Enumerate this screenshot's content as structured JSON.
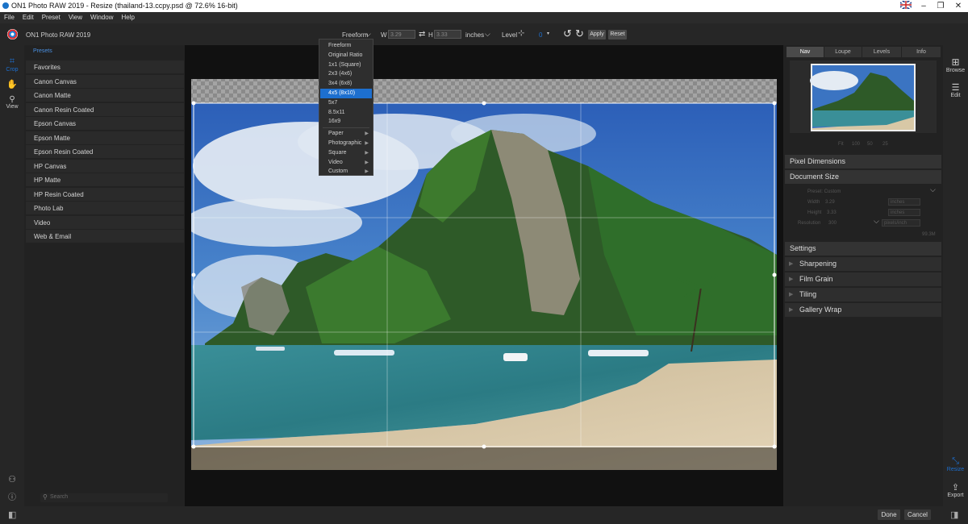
{
  "window": {
    "title": "ON1 Photo RAW 2019 - Resize (thailand-13.ccpy.psd @ 72.6% 16-bit)"
  },
  "menubar": [
    "File",
    "Edit",
    "Preset",
    "View",
    "Window",
    "Help"
  ],
  "toolbar": {
    "app_name": "ON1 Photo RAW 2019",
    "aspect": "Freeform",
    "w_label": "W",
    "w_value": "3.29",
    "h_label": "H",
    "h_value": "3.33",
    "units": "inches",
    "level_label": "Level",
    "level_value": "0",
    "apply": "Apply",
    "reset": "Reset"
  },
  "left_rail": {
    "crop": "Crop",
    "view": "View"
  },
  "presets": {
    "header": "Presets",
    "items": [
      "Favorites",
      "Canon Canvas",
      "Canon Matte",
      "Canon Resin Coated",
      "Epson Canvas",
      "Epson Matte",
      "Epson Resin Coated",
      "HP Canvas",
      "HP Matte",
      "HP Resin Coated",
      "Photo Lab",
      "Video",
      "Web & Email"
    ],
    "search_placeholder": "Search"
  },
  "dropdown": {
    "items": [
      "Freeform",
      "Original Ratio",
      "1x1 (Square)",
      "2x3 (4x6)",
      "3x4 (6x8)",
      "4x5 (8x10)",
      "5x7",
      "8.5x11",
      "16x9"
    ],
    "selected_index": 5,
    "submenus": [
      "Paper",
      "Photographic",
      "Square",
      "Video",
      "Custom"
    ]
  },
  "right_panel": {
    "tabs": [
      "Nav",
      "Loupe",
      "Levels",
      "Info"
    ],
    "active_tab": 0,
    "zoom_options": [
      "Fit",
      "100",
      "50",
      "25"
    ],
    "pixel_dimensions": "Pixel Dimensions",
    "document_size": "Document Size",
    "preset": "Preset: Custom",
    "width_row": {
      "label": "Width",
      "value": "3.29",
      "unit": "inches"
    },
    "height_row": {
      "label": "Height",
      "value": "3.33",
      "unit": "inches"
    },
    "resolution_row": {
      "label": "Resolution",
      "value": "300",
      "unit": "pixels/inch"
    },
    "size_readout": "99.3M",
    "settings": "Settings",
    "sections": [
      "Sharpening",
      "Film Grain",
      "Tiling",
      "Gallery Wrap"
    ]
  },
  "right_rail": {
    "browse": "Browse",
    "edit": "Edit",
    "resize": "Resize",
    "export": "Export"
  },
  "bottom": {
    "done": "Done",
    "cancel": "Cancel"
  },
  "colors": {
    "accent": "#1d6fcf",
    "panel_bg": "#222222",
    "toolbar_bg": "#262626"
  }
}
